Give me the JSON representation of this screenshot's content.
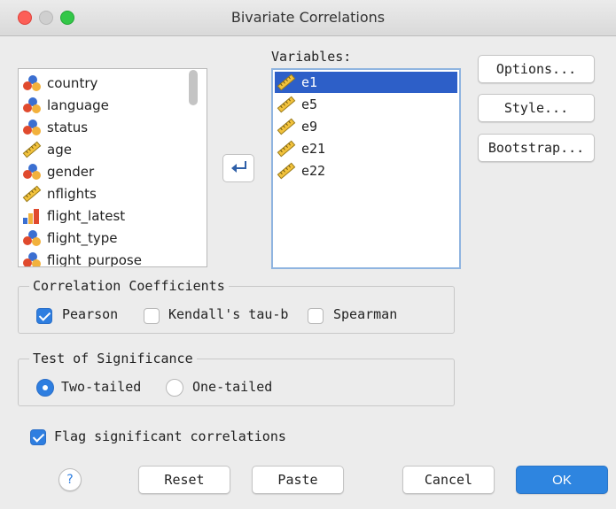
{
  "window": {
    "title": "Bivariate Correlations"
  },
  "source_list": {
    "items": [
      {
        "label": "country",
        "icon": "nominal-icon"
      },
      {
        "label": "language",
        "icon": "nominal-icon"
      },
      {
        "label": "status",
        "icon": "nominal-icon"
      },
      {
        "label": "age",
        "icon": "scale-icon"
      },
      {
        "label": "gender",
        "icon": "nominal-icon"
      },
      {
        "label": "nflights",
        "icon": "scale-icon"
      },
      {
        "label": "flight_latest",
        "icon": "ordinal-icon"
      },
      {
        "label": "flight_type",
        "icon": "nominal-icon"
      },
      {
        "label": "flight_purpose",
        "icon": "nominal-icon"
      }
    ]
  },
  "variables": {
    "label": "Variables:",
    "items": [
      {
        "label": "e1",
        "icon": "scale-icon",
        "selected": true
      },
      {
        "label": "e5",
        "icon": "scale-icon"
      },
      {
        "label": "e9",
        "icon": "scale-icon"
      },
      {
        "label": "e21",
        "icon": "scale-icon"
      },
      {
        "label": "e22",
        "icon": "scale-icon"
      }
    ]
  },
  "side_buttons": {
    "options": "Options...",
    "style": "Style...",
    "bootstrap": "Bootstrap..."
  },
  "correlation_coefficients": {
    "title": "Correlation Coefficients",
    "pearson": {
      "label": "Pearson",
      "checked": true
    },
    "kendall": {
      "label": "Kendall's tau-b",
      "checked": false
    },
    "spearman": {
      "label": "Spearman",
      "checked": false
    }
  },
  "test_of_significance": {
    "title": "Test of Significance",
    "two_tailed": {
      "label": "Two-tailed",
      "checked": true
    },
    "one_tailed": {
      "label": "One-tailed",
      "checked": false
    }
  },
  "flag_significant": {
    "label": "Flag significant correlations",
    "checked": true
  },
  "footer": {
    "help": "?",
    "reset": "Reset",
    "paste": "Paste",
    "cancel": "Cancel",
    "ok": "OK"
  },
  "colors": {
    "accent": "#2e7ee0",
    "selection": "#2d5fc8",
    "ok_button": "#2e85e0"
  }
}
